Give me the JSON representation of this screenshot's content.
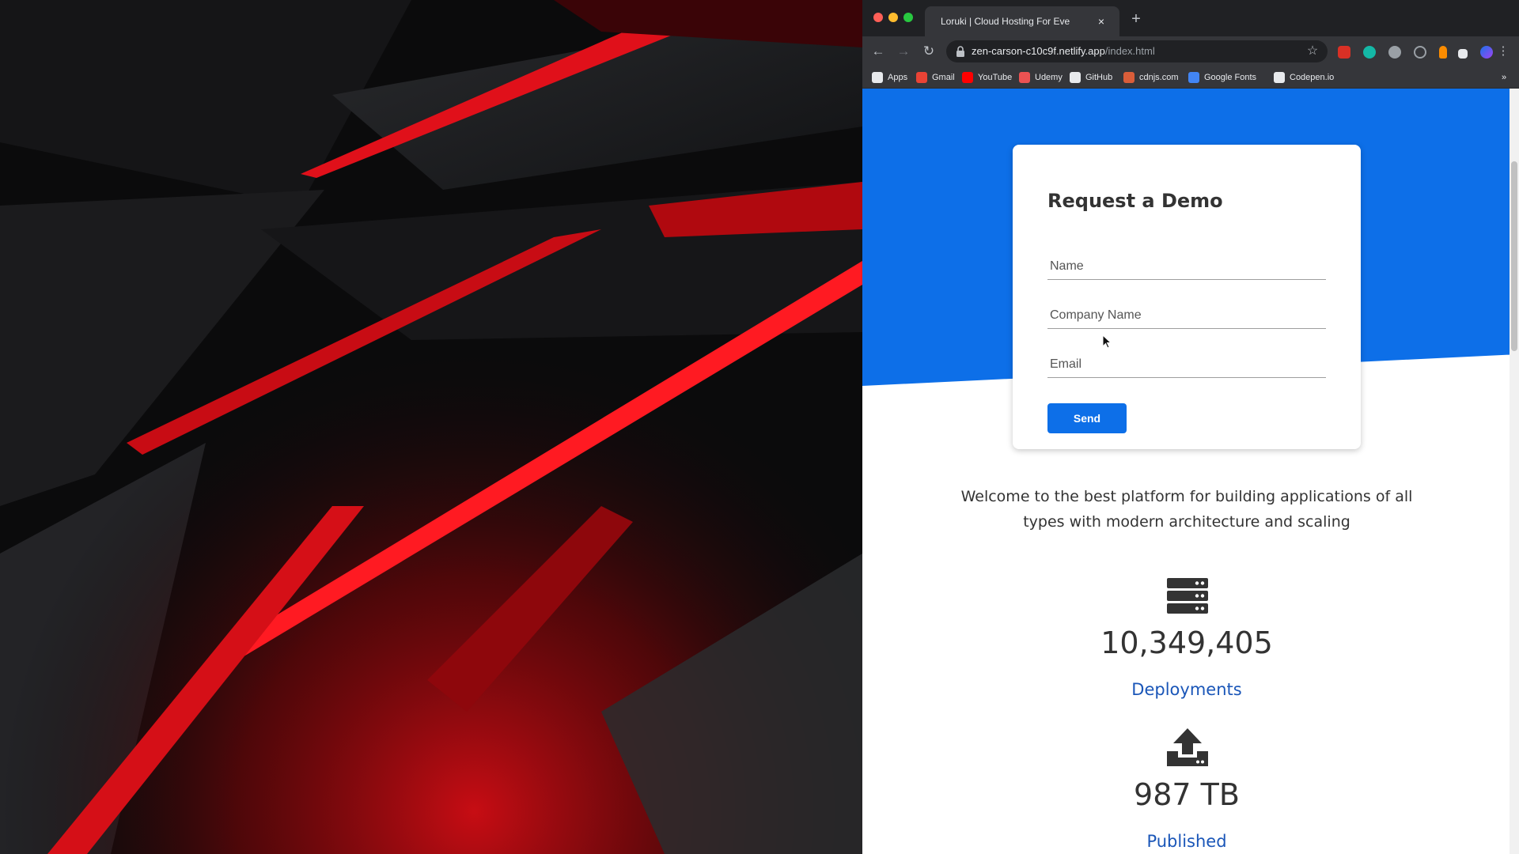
{
  "colors": {
    "hero_blue": "#0d6fe8",
    "button_blue": "#0d6fe8",
    "label_blue": "#1a56b8",
    "wallpaper_red": "#e0101a",
    "wallpaper_dark": "#0a0a0b"
  },
  "browser": {
    "tab_title": "Loruki | Cloud Hosting For Eve",
    "tab_close": "×",
    "new_tab": "+",
    "url_host": "zen-carson-c10c9f.netlify.app",
    "url_path": "/index.html",
    "nav": {
      "back": "←",
      "forward": "→",
      "reload": "↻",
      "star": "☆"
    },
    "bookmarks": [
      {
        "label": "Apps",
        "icon": "apps-grid-icon",
        "color": "#e8eaed"
      },
      {
        "label": "Gmail",
        "icon": "gmail-icon",
        "color": "#ea4335"
      },
      {
        "label": "YouTube",
        "icon": "youtube-icon",
        "color": "#ff0000"
      },
      {
        "label": "Udemy",
        "icon": "udemy-icon",
        "color": "#ec5252"
      },
      {
        "label": "GitHub",
        "icon": "github-icon",
        "color": "#e8eaed"
      },
      {
        "label": "cdnjs.com",
        "icon": "code-brackets-icon",
        "color": "#d95d39"
      },
      {
        "label": "Google Fonts",
        "icon": "google-fonts-icon",
        "color": "#4285f4"
      },
      {
        "label": "Codepen.io",
        "icon": "codepen-icon",
        "color": "#e8eaed"
      }
    ],
    "bookmarks_more": "»"
  },
  "form": {
    "title": "Request a Demo",
    "name_placeholder": "Name",
    "company_placeholder": "Company Name",
    "email_placeholder": "Email",
    "send_label": "Send"
  },
  "welcome_text": "Welcome to the best platform for building applications of all types with modern architecture and scaling",
  "stats": [
    {
      "icon": "server-icon",
      "value": "10,349,405",
      "label": "Deployments"
    },
    {
      "icon": "upload-icon",
      "value": "987 TB",
      "label": "Published"
    }
  ]
}
